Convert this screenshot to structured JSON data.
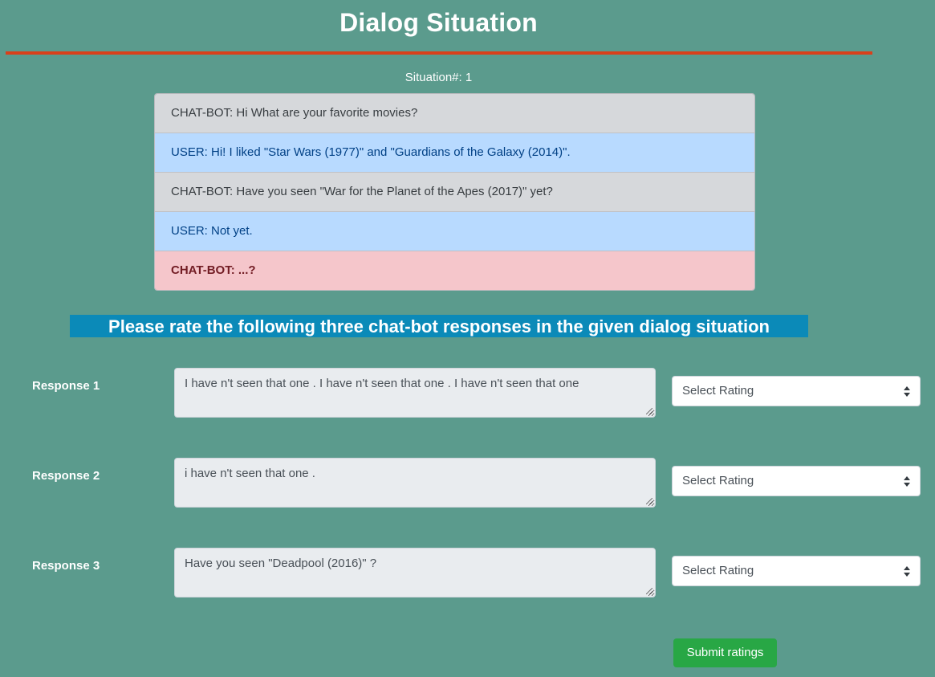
{
  "page_title": "Dialog Situation",
  "situation_label": "Situation#: 1",
  "dialog": [
    {
      "speaker": "bot",
      "text": "CHAT-BOT: Hi What are your favorite movies?"
    },
    {
      "speaker": "user",
      "text": "USER: Hi! I liked \"Star Wars (1977)\" and \"Guardians of the Galaxy (2014)\"."
    },
    {
      "speaker": "bot",
      "text": "CHAT-BOT: Have you seen \"War for the Planet of the Apes (2017)\" yet?"
    },
    {
      "speaker": "user",
      "text": "USER: Not yet."
    },
    {
      "speaker": "pending",
      "text": "CHAT-BOT: ...?"
    }
  ],
  "instruction": "Please rate the following three chat-bot responses in the given dialog situation",
  "responses": [
    {
      "label": "Response 1",
      "text": "I have n't seen that one . I have n't seen that one . I have n't seen that one",
      "rating": "Select Rating"
    },
    {
      "label": "Response 2",
      "text": "i have n't seen that one .",
      "rating": "Select Rating"
    },
    {
      "label": "Response 3",
      "text": "Have you seen \"Deadpool (2016)\" ?",
      "rating": "Select Rating"
    }
  ],
  "submit_label": "Submit ratings",
  "colors": {
    "background": "#5b9b8d",
    "title_rule": "#d9401a",
    "bot_turn": "#d6d8db",
    "user_turn": "#b8daff",
    "pending_turn": "#f5c6cb",
    "instruction_banner": "#0b8ab8",
    "submit_button": "#28a745"
  }
}
